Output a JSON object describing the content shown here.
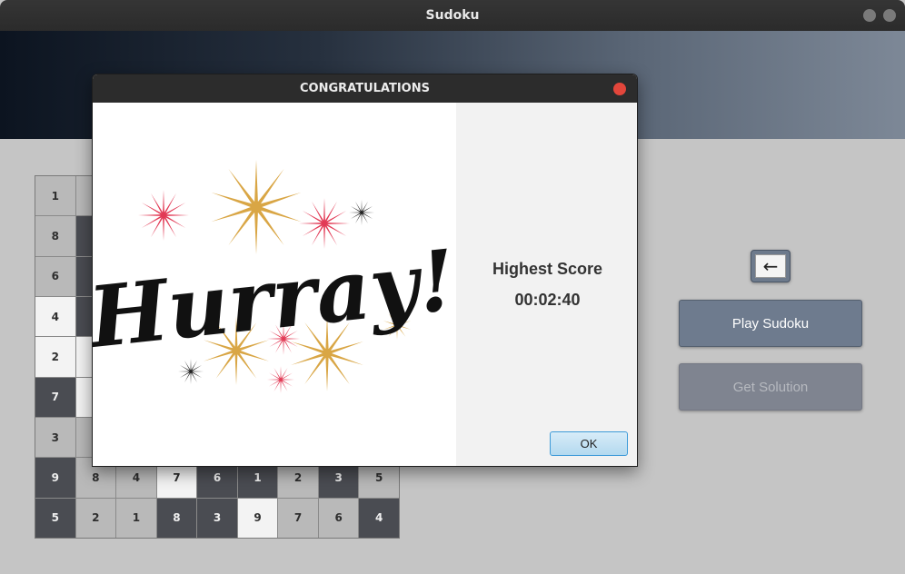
{
  "window": {
    "title": "Sudoku"
  },
  "board": [
    [
      {
        "v": "1",
        "t": "light"
      },
      {
        "v": "",
        "t": "light"
      },
      {
        "v": "",
        "t": "light"
      },
      {
        "v": "",
        "t": "light"
      },
      {
        "v": "",
        "t": "light"
      },
      {
        "v": "",
        "t": "light"
      },
      {
        "v": "",
        "t": "light"
      },
      {
        "v": "",
        "t": "light"
      },
      {
        "v": "",
        "t": "light"
      }
    ],
    [
      {
        "v": "8",
        "t": "light"
      },
      {
        "v": "",
        "t": "dark"
      },
      {
        "v": "",
        "t": "light"
      },
      {
        "v": "",
        "t": "light"
      },
      {
        "v": "",
        "t": "light"
      },
      {
        "v": "",
        "t": "light"
      },
      {
        "v": "",
        "t": "light"
      },
      {
        "v": "",
        "t": "light"
      },
      {
        "v": "",
        "t": "light"
      }
    ],
    [
      {
        "v": "6",
        "t": "light"
      },
      {
        "v": "",
        "t": "dark"
      },
      {
        "v": "",
        "t": "light"
      },
      {
        "v": "",
        "t": "light"
      },
      {
        "v": "",
        "t": "light"
      },
      {
        "v": "",
        "t": "light"
      },
      {
        "v": "",
        "t": "light"
      },
      {
        "v": "",
        "t": "light"
      },
      {
        "v": "",
        "t": "light"
      }
    ],
    [
      {
        "v": "4",
        "t": "white"
      },
      {
        "v": "",
        "t": "dark"
      },
      {
        "v": "",
        "t": "light"
      },
      {
        "v": "",
        "t": "light"
      },
      {
        "v": "",
        "t": "light"
      },
      {
        "v": "",
        "t": "light"
      },
      {
        "v": "",
        "t": "light"
      },
      {
        "v": "",
        "t": "light"
      },
      {
        "v": "",
        "t": "light"
      }
    ],
    [
      {
        "v": "2",
        "t": "white"
      },
      {
        "v": "",
        "t": "white"
      },
      {
        "v": "",
        "t": "light"
      },
      {
        "v": "",
        "t": "light"
      },
      {
        "v": "",
        "t": "light"
      },
      {
        "v": "",
        "t": "light"
      },
      {
        "v": "",
        "t": "light"
      },
      {
        "v": "",
        "t": "light"
      },
      {
        "v": "",
        "t": "light"
      }
    ],
    [
      {
        "v": "7",
        "t": "dark"
      },
      {
        "v": "",
        "t": "white"
      },
      {
        "v": "",
        "t": "light"
      },
      {
        "v": "",
        "t": "light"
      },
      {
        "v": "",
        "t": "light"
      },
      {
        "v": "",
        "t": "light"
      },
      {
        "v": "",
        "t": "light"
      },
      {
        "v": "",
        "t": "light"
      },
      {
        "v": "",
        "t": "light"
      }
    ],
    [
      {
        "v": "3",
        "t": "light"
      },
      {
        "v": "",
        "t": "light"
      },
      {
        "v": "",
        "t": "light"
      },
      {
        "v": "",
        "t": "light"
      },
      {
        "v": "",
        "t": "light"
      },
      {
        "v": "",
        "t": "light"
      },
      {
        "v": "",
        "t": "light"
      },
      {
        "v": "",
        "t": "light"
      },
      {
        "v": "",
        "t": "light"
      }
    ],
    [
      {
        "v": "9",
        "t": "dark"
      },
      {
        "v": "8",
        "t": "light"
      },
      {
        "v": "4",
        "t": "light"
      },
      {
        "v": "7",
        "t": "white"
      },
      {
        "v": "6",
        "t": "dark"
      },
      {
        "v": "1",
        "t": "dark"
      },
      {
        "v": "2",
        "t": "light"
      },
      {
        "v": "3",
        "t": "dark"
      },
      {
        "v": "5",
        "t": "light"
      }
    ],
    [
      {
        "v": "5",
        "t": "dark"
      },
      {
        "v": "2",
        "t": "light"
      },
      {
        "v": "1",
        "t": "light"
      },
      {
        "v": "8",
        "t": "dark"
      },
      {
        "v": "3",
        "t": "dark"
      },
      {
        "v": "9",
        "t": "white"
      },
      {
        "v": "7",
        "t": "light"
      },
      {
        "v": "6",
        "t": "light"
      },
      {
        "v": "4",
        "t": "dark"
      }
    ]
  ],
  "controls": {
    "back_glyph": "←",
    "play_label": "Play Sudoku",
    "solution_label": "Get Solution"
  },
  "dialog": {
    "title": "CONGRATULATIONS",
    "image_text": "Hurray!",
    "score_label": "Highest Score",
    "score_value": "00:02:40",
    "ok_label": "OK"
  },
  "colors": {
    "accent_blue": "#6e7b8e",
    "close_red": "#e2463b",
    "star_gold": "#d9a645",
    "star_red": "#e23a55",
    "star_black": "#222222"
  }
}
